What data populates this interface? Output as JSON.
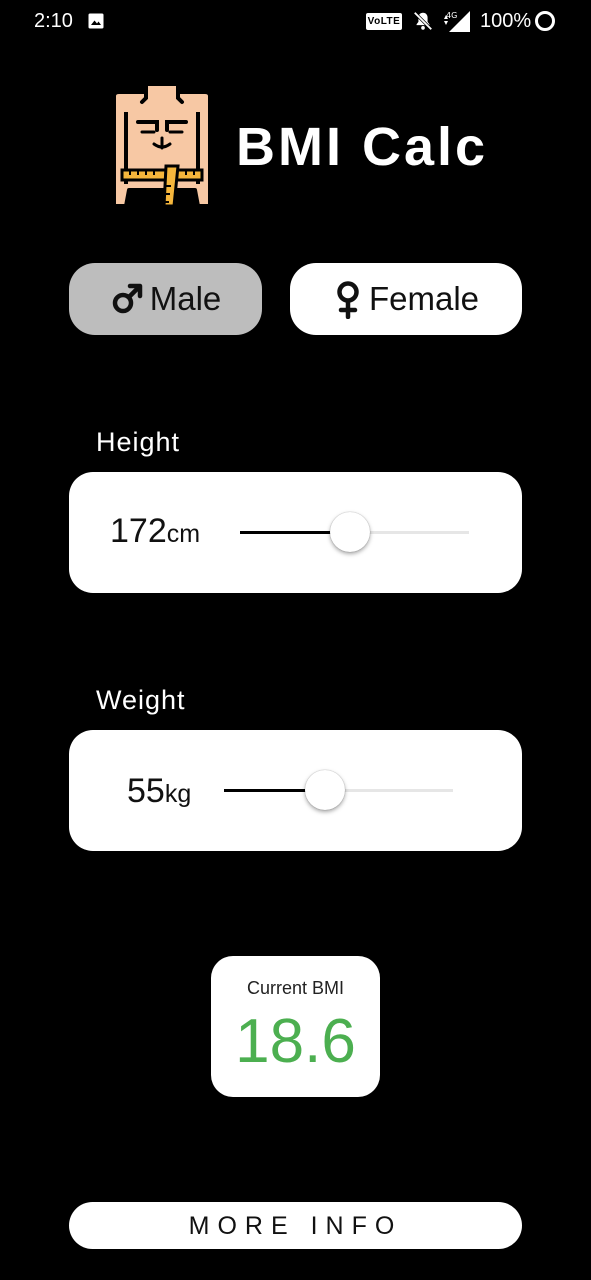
{
  "status_bar": {
    "time": "2:10",
    "volte": "VoLTE",
    "network": "4G",
    "battery": "100%",
    "icons": [
      "image-icon",
      "volte-icon",
      "bell-muted-icon",
      "signal-icon",
      "battery-ring-icon"
    ]
  },
  "header": {
    "title": "BMI Calc",
    "logo_icon": "body-measuring-tape-icon"
  },
  "gender": {
    "male_label": "Male",
    "female_label": "Female",
    "selected": "Male",
    "male_icon": "male-symbol-icon",
    "female_icon": "female-symbol-icon"
  },
  "height": {
    "label": "Height",
    "value": "172",
    "unit": "cm",
    "slider_fraction": 0.48
  },
  "weight": {
    "label": "Weight",
    "value": "55",
    "unit": "kg",
    "slider_fraction": 0.44
  },
  "bmi": {
    "label": "Current BMI",
    "value": "18.6",
    "value_color": "#4caf50"
  },
  "more_info_label": "MORE INFO",
  "colors": {
    "background": "#000000",
    "selected_gender": "#bdbdbd",
    "card": "#ffffff",
    "bmi_green": "#4caf50"
  }
}
